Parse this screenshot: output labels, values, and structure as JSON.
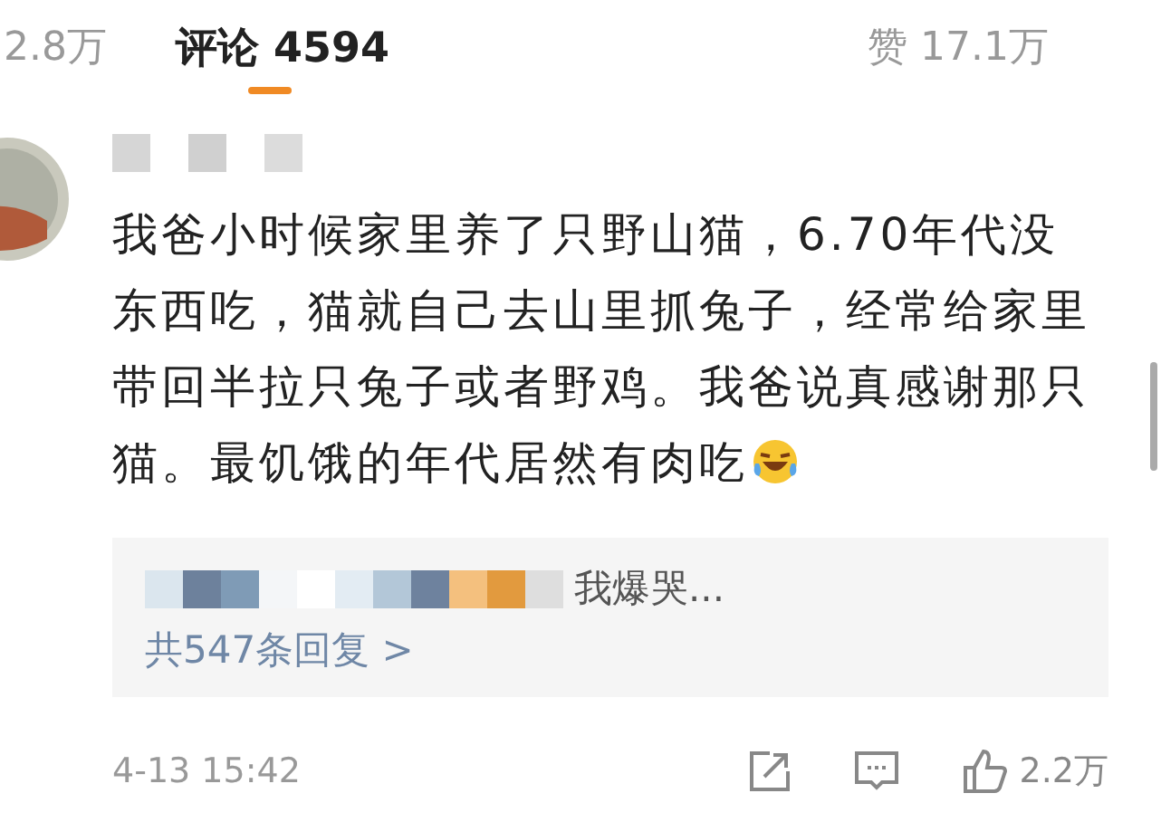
{
  "tabs": [
    {
      "label": "2.8万",
      "selected": false
    },
    {
      "label": "评论 4594",
      "selected": true
    },
    {
      "label": "赞 17.1万",
      "selected": false
    }
  ],
  "comment": {
    "text_lines": [
      "我爸小时候家里养了只野山猫，6.70年代没",
      "东西吃，猫就自己去山里抓兔子，经常给家里",
      "带回半拉只兔子或者野鸡。我爸说真感谢那只",
      "猫。最饥饿的年代居然有肉吃"
    ],
    "reply": {
      "text": "我爆哭...",
      "more": "共547条回复 >"
    },
    "time": "4-13 15:42",
    "likes": "2.2万"
  }
}
